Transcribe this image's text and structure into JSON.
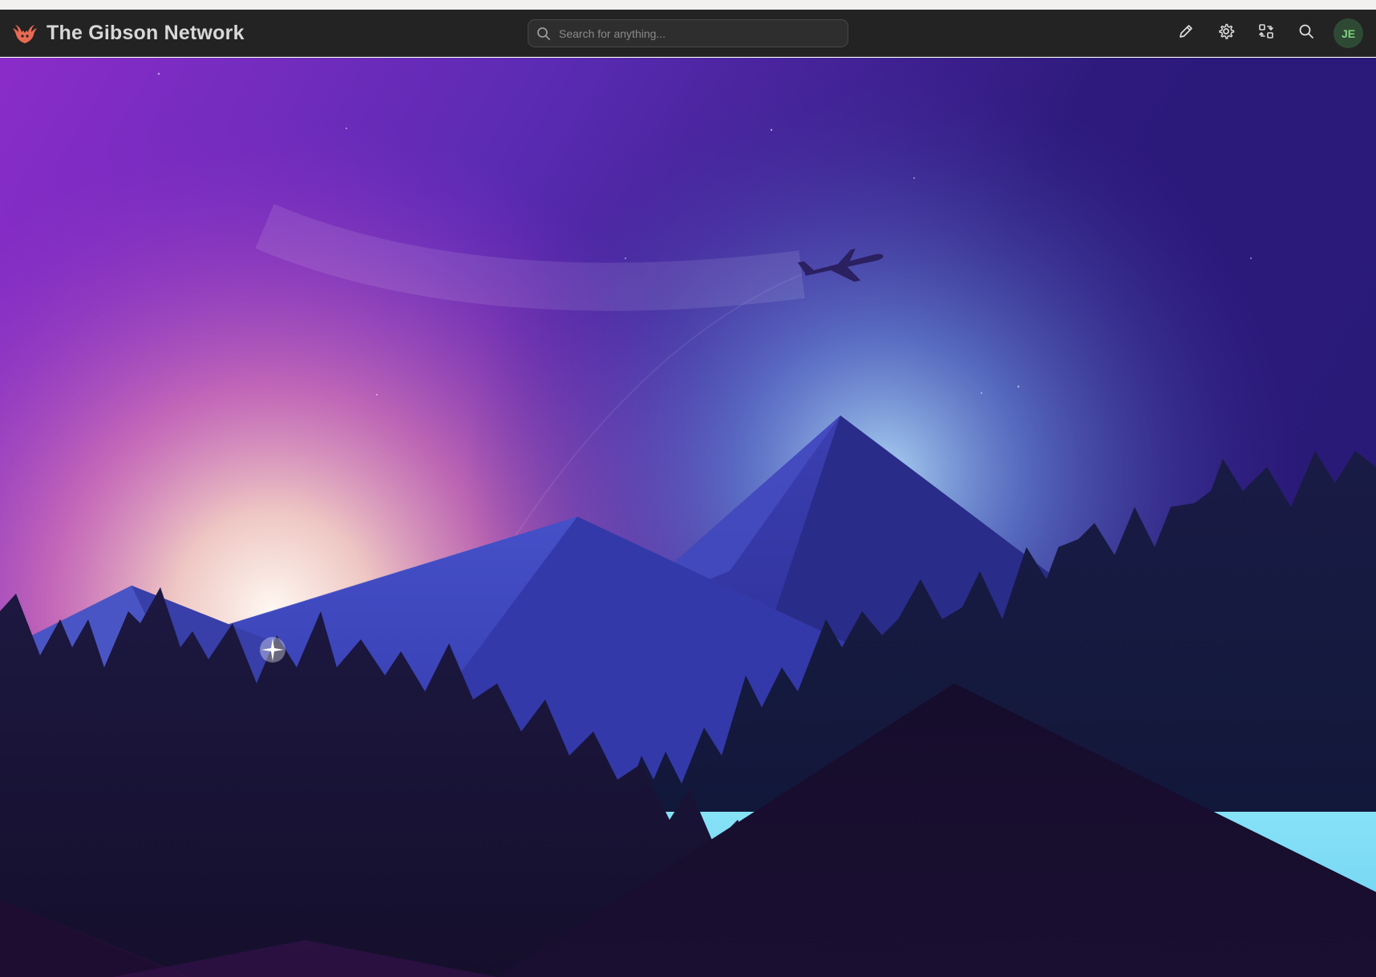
{
  "app": {
    "title": "The Gibson Network"
  },
  "search": {
    "placeholder": "Search for anything..."
  },
  "toolbar": {
    "icons": [
      "edit-icon",
      "gear-icon",
      "switch-workspace-icon",
      "search-icon"
    ]
  },
  "user": {
    "initials": "JE"
  },
  "colors": {
    "topbar": "#232323",
    "brand_text": "#d8d8d8",
    "avatar_bg": "#2f4a34",
    "avatar_text": "#7fd27f",
    "logo": "#e86a52"
  },
  "hero": {
    "scene": "mountain-landscape-illustration"
  }
}
